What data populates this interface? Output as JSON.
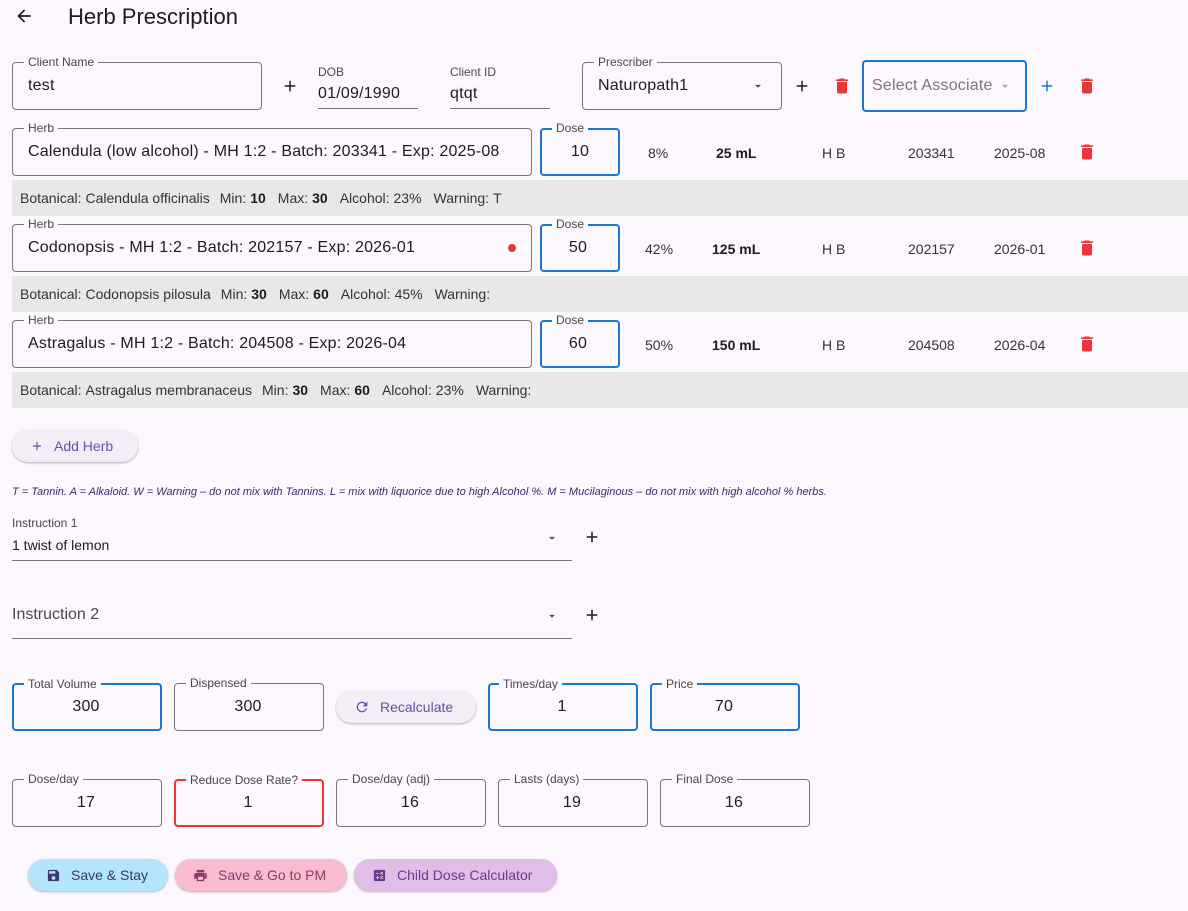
{
  "header": {
    "title": "Herb Prescription",
    "back_icon": "arrow-left-icon"
  },
  "client": {
    "name_label": "Client Name",
    "name_value": "test",
    "dob_label": "DOB",
    "dob_value": "01/09/1990",
    "id_label": "Client ID",
    "id_value": "qtqt",
    "prescriber_label": "Prescriber",
    "prescriber_value": "Naturopath1",
    "associate_placeholder": "Select Associate"
  },
  "herbs": [
    {
      "herb_label": "Herb",
      "name": "Calendula (low alcohol) - MH 1:2 - Batch: 203341 - Exp: 2025-08",
      "dose_label": "Dose",
      "dose": "10",
      "percent": "8%",
      "volume": "25 mL",
      "flags": "H B",
      "batch": "203341",
      "exp": "2025-08",
      "has_dot": false,
      "botanical_label": "Botanical:",
      "botanical": "Calendula officinalis",
      "min_label": "Min:",
      "min": "10",
      "max_label": "Max:",
      "max": "30",
      "alcohol_label": "Alcohol:",
      "alcohol": "23%",
      "warning_label": "Warning:",
      "warning": "T"
    },
    {
      "herb_label": "Herb",
      "name": "Codonopsis - MH 1:2 - Batch: 202157 - Exp: 2026-01",
      "dose_label": "Dose",
      "dose": "50",
      "percent": "42%",
      "volume": "125 mL",
      "flags": "H B",
      "batch": "202157",
      "exp": "2026-01",
      "has_dot": true,
      "botanical_label": "Botanical:",
      "botanical": "Codonopsis pilosula",
      "min_label": "Min:",
      "min": "30",
      "max_label": "Max:",
      "max": "60",
      "alcohol_label": "Alcohol:",
      "alcohol": "45%",
      "warning_label": "Warning:",
      "warning": ""
    },
    {
      "herb_label": "Herb",
      "name": "Astragalus - MH 1:2 - Batch: 204508 - Exp: 2026-04",
      "dose_label": "Dose",
      "dose": "60",
      "percent": "50%",
      "volume": "150 mL",
      "flags": "H B",
      "batch": "204508",
      "exp": "2026-04",
      "has_dot": false,
      "botanical_label": "Botanical:",
      "botanical": "Astragalus membranaceus",
      "min_label": "Min:",
      "min": "30",
      "max_label": "Max:",
      "max": "60",
      "alcohol_label": "Alcohol:",
      "alcohol": "23%",
      "warning_label": "Warning:",
      "warning": ""
    }
  ],
  "add_herb_label": "Add Herb",
  "legend_note": "T = Tannin. A = Alkaloid. W = Warning – do not mix with Tannins. L = mix with liquorice due to high Alcohol %. M = Mucilaginous – do not mix with high alcohol % herbs.",
  "instructions": {
    "i1_label": "Instruction 1",
    "i1_value": "1 twist of lemon",
    "i2_label": "Instruction 2"
  },
  "totals": {
    "total_volume_label": "Total Volume",
    "total_volume": "300",
    "dispensed_label": "Dispensed",
    "dispensed": "300",
    "recalculate_label": "Recalculate",
    "times_label": "Times/day",
    "times": "1",
    "price_label": "Price",
    "price": "70"
  },
  "dose_calc": {
    "dose_day_label": "Dose/day",
    "dose_day": "17",
    "reduce_label": "Reduce Dose Rate?",
    "reduce": "1",
    "dose_adj_label": "Dose/day (adj)",
    "dose_adj": "16",
    "lasts_label": "Lasts (days)",
    "lasts": "19",
    "final_label": "Final Dose",
    "final": "16"
  },
  "actions": {
    "save_stay": "Save & Stay",
    "save_pm": "Save & Go to PM",
    "child_calc": "Child Dose Calculator"
  },
  "colors": {
    "blue": "#1976d2",
    "red": "#e53935",
    "save_stay_bg": "#b3e5fc",
    "save_pm_bg": "#f8bbd0",
    "child_bg": "#e1bee7"
  }
}
